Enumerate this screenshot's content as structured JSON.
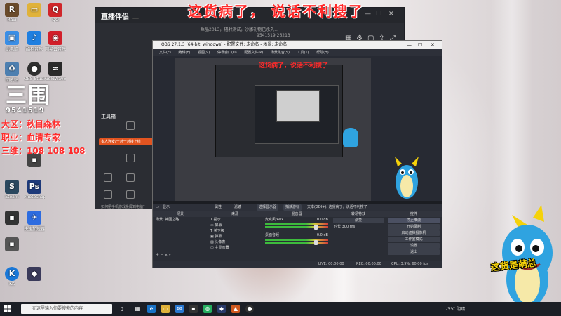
{
  "caption": {
    "top": "这货病了， 说话不利搜了",
    "nested": "这货病了，说话不利搜了"
  },
  "streamer": {
    "logo": "三围",
    "number": "9541519",
    "lines": [
      "大区：秋目森林",
      "职业：血清专家",
      "三维：108 108 108"
    ]
  },
  "desktop_icons": [
    {
      "label": "Ravi",
      "icon": "ravi-icon",
      "color": "#6a4a2a"
    },
    {
      "label": "",
      "icon": "folder-icon",
      "color": "#e0b23a"
    },
    {
      "label": "QQ",
      "icon": "qq-penguin-icon",
      "color": "#d0262a"
    },
    {
      "label": "此电脑",
      "icon": "computer-icon",
      "color": "#3a8ee6"
    },
    {
      "label": "酷狗音乐",
      "icon": "music-icon",
      "color": "#1f7fe0"
    },
    {
      "label": "网易云音乐",
      "icon": "netease-music-icon",
      "color": "#d21f2a"
    },
    {
      "label": "回收站",
      "icon": "recycle-bin-icon",
      "color": "#4d7fb0"
    },
    {
      "label": "OBS Studio",
      "icon": "obs-icon",
      "color": "#303030"
    },
    {
      "label": "GoldWave",
      "icon": "goldwave-icon",
      "color": "#2a2a2a"
    },
    {
      "label": "Photoshop",
      "icon": "photoshop-icon",
      "color": "#1e3a7a"
    },
    {
      "label": "Steam",
      "icon": "steam-icon",
      "color": "#2a475e"
    },
    {
      "label": "",
      "icon": "app-icon",
      "color": "#444444"
    },
    {
      "label": "快速加速器",
      "icon": "boost-icon",
      "color": "#2d6ce0"
    },
    {
      "label": "",
      "icon": "app-icon",
      "color": "#333333"
    },
    {
      "label": "",
      "icon": "app-icon",
      "color": "#555555"
    },
    {
      "label": "KK",
      "icon": "k-icon",
      "color": "#1a78d8"
    },
    {
      "label": "",
      "icon": "game-icon",
      "color": "#3a3a5a"
    }
  ],
  "helper": {
    "brand": "直播伴侣",
    "badge": "",
    "stats_line": "鱼晶2013，辐射测试，沙雕礼物已永久...",
    "stats_line2": "9541519  26213",
    "tools_label": "工具箱",
    "promo": "多人连麦/一对一对接上线",
    "hint": "如何把手机游戏投屏到电脑？"
  },
  "obs": {
    "title": "OBS 27.1.3 (64-bit, windows) - 配置文件: 未命名 - 场景: 未命名",
    "menu": [
      "文件(F)",
      "编辑(E)",
      "视图(V)",
      "停靠窗口(D)",
      "配置文件(P)",
      "场景集合(S)",
      "工具(T)",
      "帮助(H)"
    ],
    "source_bar": {
      "name": "显示",
      "props": "属性",
      "filter": "滤镜",
      "select_display": "选择显示器",
      "capture": "捕获游标"
    },
    "text_tab": "文本(GDI+): 这货病了，说话不利搜了",
    "scenes": {
      "header": "场景",
      "items": [
        "场景: 神回之路"
      ]
    },
    "sources": {
      "header": "来源",
      "items": [
        "提示",
        "屏幕",
        "关下级",
        "弹幕",
        "头像表",
        "主显示器"
      ]
    },
    "mixer": {
      "header": "混音器",
      "channels": [
        {
          "name": "麦克风/Aux",
          "db": "0.0 dB"
        },
        {
          "name": "桌面音频",
          "db": "0.0 dB"
        }
      ]
    },
    "transitions": {
      "header": "转场特效",
      "type": "渐变",
      "duration_label": "时长",
      "duration": "300 ms"
    },
    "controls": {
      "header": "控件",
      "buttons": [
        "停止推流",
        "开始录制",
        "启动虚拟摄像机",
        "工作室模式",
        "设置",
        "退出"
      ]
    },
    "status": {
      "live": "LIVE: 00:00:00",
      "rec": "REC: 00:00:00",
      "cpu": "CPU: 3.9%, 60.00 fps"
    }
  },
  "taskbar": {
    "search_placeholder": "在这里输入你要搜索的内容",
    "weather": "-3°C 阴晴",
    "lang": "中"
  },
  "mascot_caption": [
    "这货是萌总",
    ""
  ]
}
